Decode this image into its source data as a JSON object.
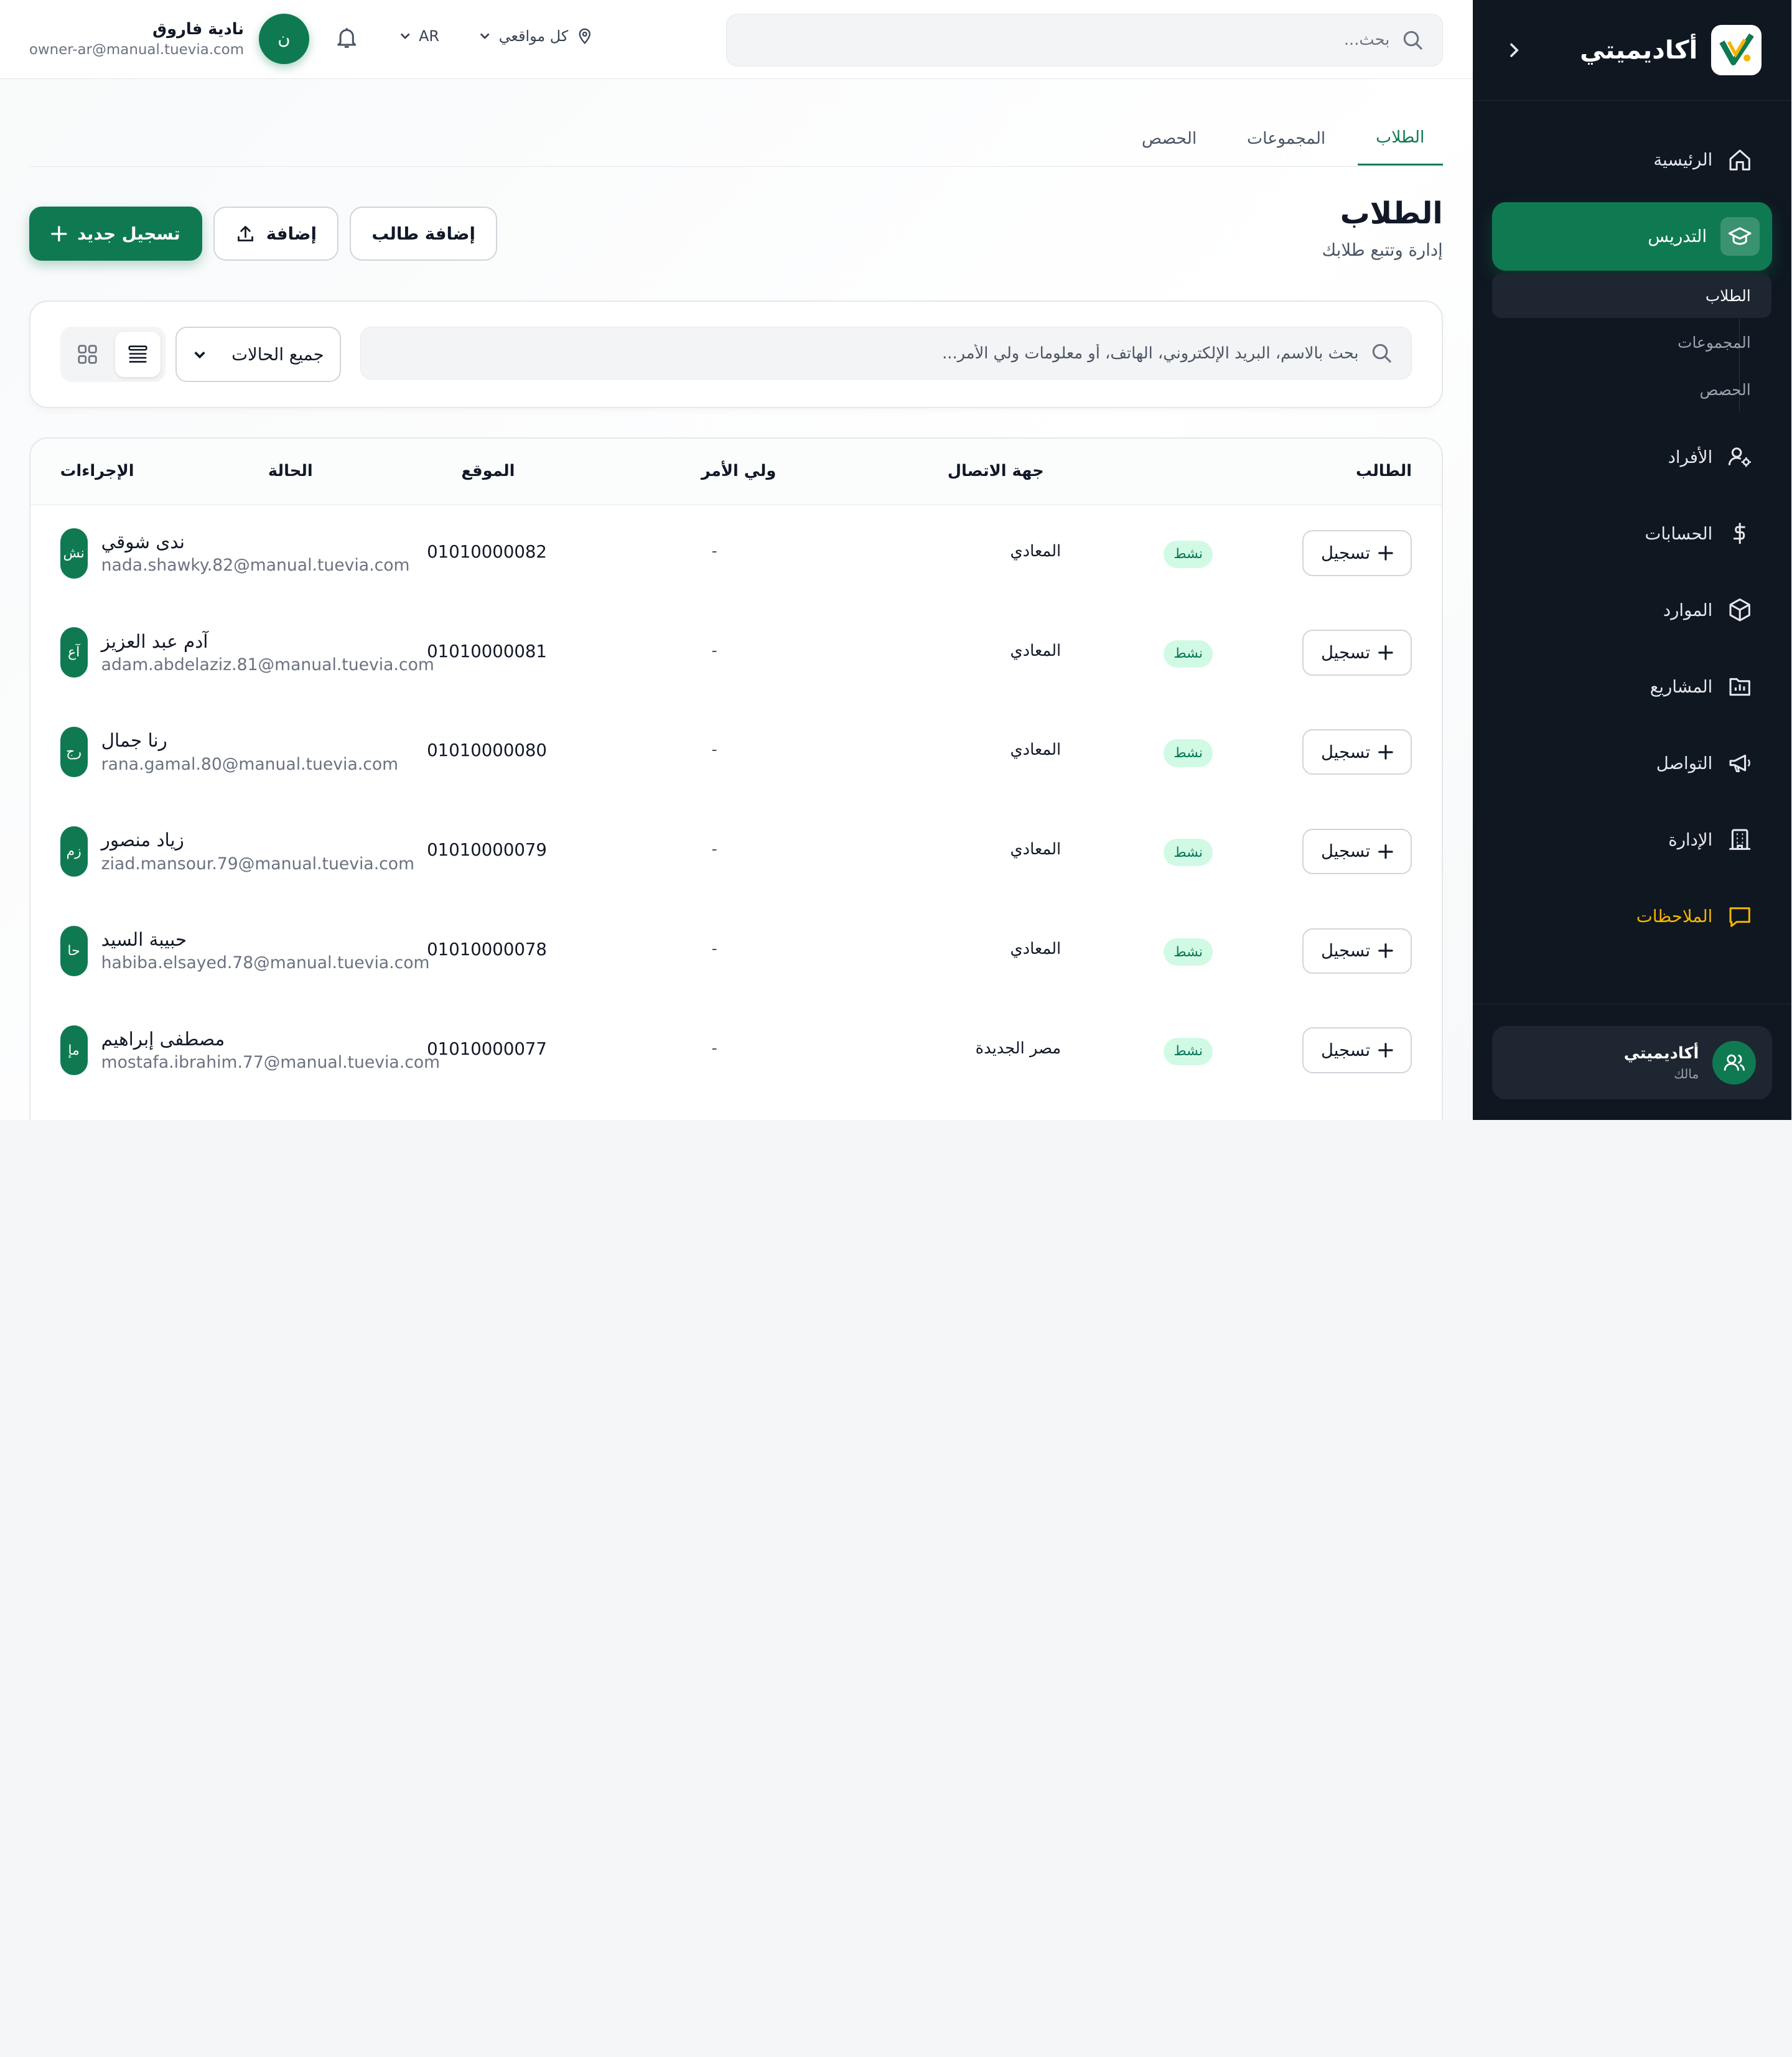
{
  "brand": {
    "name": "أكاديميتي"
  },
  "sidebar": {
    "items": [
      {
        "label": "الرئيسية",
        "icon": "home-icon"
      },
      {
        "label": "التدريس",
        "icon": "graduation-cap-icon",
        "active": true
      },
      {
        "label": "الأفراد",
        "icon": "user-gear-icon"
      },
      {
        "label": "الحسابات",
        "icon": "dollar-icon"
      },
      {
        "label": "الموارد",
        "icon": "box-icon"
      },
      {
        "label": "المشاريع",
        "icon": "folder-chart-icon"
      },
      {
        "label": "التواصل",
        "icon": "megaphone-icon"
      },
      {
        "label": "الإدارة",
        "icon": "building-icon"
      },
      {
        "label": "الملاحظات",
        "icon": "chat-icon"
      }
    ],
    "subitems": [
      "الطلاب",
      "المجموعات",
      "الحصص"
    ],
    "org": {
      "name": "أكاديميتي",
      "role": "مالك"
    }
  },
  "topbar": {
    "search_placeholder": "بحث...",
    "location": "كل مواقعي",
    "language": "AR",
    "user": {
      "initial": "ن",
      "name": "نادية فاروق",
      "email": "owner-ar@manual.tuevia.com"
    }
  },
  "tabs": [
    "الطلاب",
    "المجموعات",
    "الحصص"
  ],
  "page": {
    "title": "الطلاب",
    "subtitle": "إدارة وتتبع طلابك"
  },
  "actions": {
    "new_enroll": "تسجيل جديد",
    "upload": "إضافة",
    "add_student": "إضافة طالب"
  },
  "filters": {
    "search_placeholder": "بحث بالاسم، البريد الإلكتروني، الهاتف، أو معلومات ولي الأمر...",
    "status": "جميع الحالات"
  },
  "table": {
    "headers": {
      "student": "الطالب",
      "contact": "جهة الاتصال",
      "guardian": "ولي الأمر",
      "location": "الموقع",
      "status": "الحالة",
      "actions": "الإجراءات"
    },
    "enroll_label": "تسجيل",
    "rows": [
      {
        "initials": "نش",
        "name": "ندى شوقي",
        "email": "nada.shawky.82@manual.tuevia.com",
        "location": "01010000082",
        "guardian": "-",
        "contact": "المعادي",
        "status": "نشط"
      },
      {
        "initials": "آع",
        "name": "آدم عبد العزيز",
        "email": "adam.abdelaziz.81@manual.tuevia.com",
        "location": "01010000081",
        "guardian": "-",
        "contact": "المعادي",
        "status": "نشط"
      },
      {
        "initials": "رج",
        "name": "رنا جمال",
        "email": "rana.gamal.80@manual.tuevia.com",
        "location": "01010000080",
        "guardian": "-",
        "contact": "المعادي",
        "status": "نشط"
      },
      {
        "initials": "زم",
        "name": "زياد منصور",
        "email": "ziad.mansour.79@manual.tuevia.com",
        "location": "01010000079",
        "guardian": "-",
        "contact": "المعادي",
        "status": "نشط"
      },
      {
        "initials": "حا",
        "name": "حبيبة السيد",
        "email": "habiba.elsayed.78@manual.tuevia.com",
        "location": "01010000078",
        "guardian": "-",
        "contact": "المعادي",
        "status": "نشط"
      },
      {
        "initials": "مإ",
        "name": "مصطفى إبراهيم",
        "email": "mostafa.ibrahim.77@manual.tuevia.com",
        "location": "01010000077",
        "guardian": "-",
        "contact": "مصر الجديدة",
        "status": "نشط"
      }
    ]
  },
  "colors": {
    "brand": "#0f7a52",
    "sidebar": "#0f1720",
    "notes": "#f5b400",
    "status_bg": "#d1fae5"
  }
}
